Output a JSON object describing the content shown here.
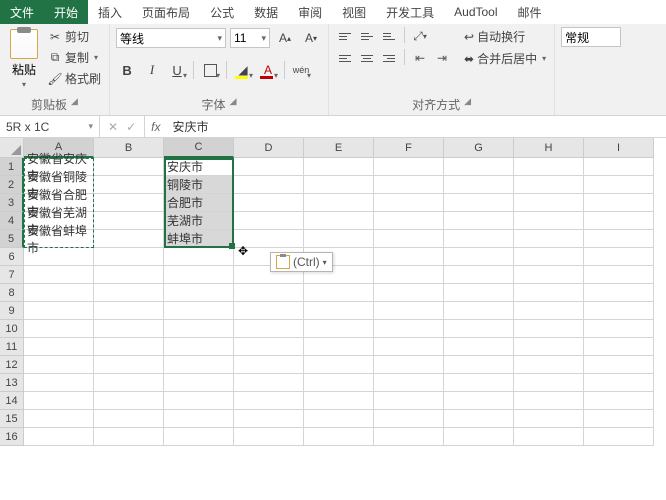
{
  "tabs": {
    "file": "文件",
    "home": "开始",
    "insert": "插入",
    "layout": "页面布局",
    "formulas": "公式",
    "data": "数据",
    "review": "审阅",
    "view": "视图",
    "dev": "开发工具",
    "aud": "AudTool",
    "mail": "邮件"
  },
  "clipboard": {
    "paste": "粘贴",
    "cut": "剪切",
    "copy": "复制",
    "painter": "格式刷",
    "group": "剪贴板"
  },
  "font": {
    "name": "等线",
    "size": "11",
    "group": "字体"
  },
  "align": {
    "wrap": "自动换行",
    "merge": "合并后居中",
    "group": "对齐方式"
  },
  "number": {
    "format": "常规"
  },
  "namebox": "5R x 1C",
  "formula": "安庆市",
  "columns": [
    "A",
    "B",
    "C",
    "D",
    "E",
    "F",
    "G",
    "H",
    "I"
  ],
  "rows": [
    "1",
    "2",
    "3",
    "4",
    "5",
    "6",
    "7",
    "8",
    "9",
    "10",
    "11",
    "12",
    "13",
    "14",
    "15",
    "16"
  ],
  "cells": {
    "A": [
      "安徽省安庆市",
      "安徽省铜陵市",
      "安徽省合肥市",
      "安徽省芜湖市",
      "安徽省蚌埠市"
    ],
    "C": [
      "安庆市",
      "铜陵市",
      "合肥市",
      "芜湖市",
      "蚌埠市"
    ]
  },
  "pasteopt": "(Ctrl)",
  "chart_data": {
    "type": "table",
    "columns": [
      "A",
      "C"
    ],
    "rows": [
      {
        "A": "安徽省安庆市",
        "C": "安庆市"
      },
      {
        "A": "安徽省铜陵市",
        "C": "铜陵市"
      },
      {
        "A": "安徽省合肥市",
        "C": "合肥市"
      },
      {
        "A": "安徽省芜湖市",
        "C": "芜湖市"
      },
      {
        "A": "安徽省蚌埠市",
        "C": "蚌埠市"
      }
    ]
  }
}
